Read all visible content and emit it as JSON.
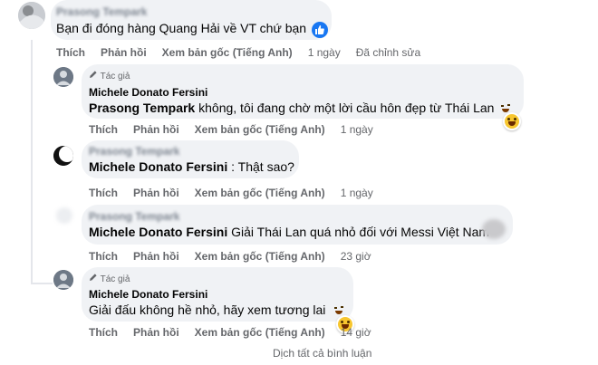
{
  "comments": [
    {
      "name": "Prasong Tempark",
      "text": "Bạn đi đóng hàng Quang Hải về VT chứ bạn",
      "actions": {
        "like": "Thích",
        "reply": "Phản hồi",
        "translate": "Xem bản gốc (Tiếng Anh)",
        "time": "1 ngày",
        "edited": "Đã chỉnh sửa"
      }
    },
    {
      "badge": "Tác giả",
      "name": "Michele Donato Fersini",
      "mention": "Prasong Tempark",
      "text": " không, tôi đang chờ một lời cầu hôn đẹp từ Thái Lan",
      "actions": {
        "like": "Thích",
        "reply": "Phản hồi",
        "translate": "Xem bản gốc (Tiếng Anh)",
        "time": "1 ngày"
      }
    },
    {
      "name": "Prasong Tempark",
      "mention": "Michele Donato Fersini",
      "text": " : Thật sao?",
      "actions": {
        "like": "Thích",
        "reply": "Phản hồi",
        "translate": "Xem bản gốc (Tiếng Anh)",
        "time": "1 ngày"
      }
    },
    {
      "name": "Prasong Tempark",
      "mention": "Michele Donato Fersini",
      "text": " Giải Thái Lan quá nhỏ đối với Messi Việt Nam",
      "actions": {
        "like": "Thích",
        "reply": "Phản hồi",
        "translate": "Xem bản gốc (Tiếng Anh)",
        "time": "23 giờ"
      }
    },
    {
      "badge": "Tác giả",
      "name": "Michele Donato Fersini",
      "text": "Giải đấu không hề nhỏ, hãy xem tương lai",
      "actions": {
        "like": "Thích",
        "reply": "Phản hồi",
        "translate": "Xem bản gốc (Tiếng Anh)",
        "time": "14 giờ"
      }
    }
  ],
  "footer": {
    "translate_all": "Dịch tất cả bình luận"
  },
  "icons": {
    "pencil": "pencil-icon",
    "like_reaction": "like-reaction-icon",
    "haha_reaction": "haha-reaction-icon",
    "wink_emoji": "wink-emoji-icon"
  },
  "colors": {
    "bubble": "#f0f2f5",
    "muted": "#65676b",
    "like_blue": "#1877f2",
    "thread_line": "#e4e6eb"
  }
}
